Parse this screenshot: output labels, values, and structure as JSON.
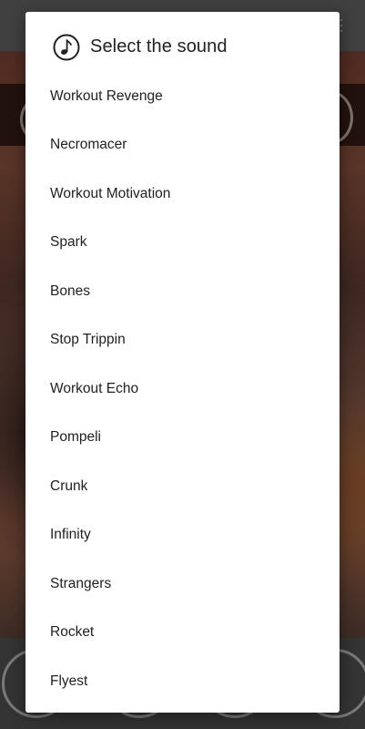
{
  "dialog": {
    "title": "Select the sound",
    "icon": "music-note-icon",
    "items": [
      {
        "label": "Workout Revenge"
      },
      {
        "label": "Necromacer"
      },
      {
        "label": "Workout Motivation"
      },
      {
        "label": "Spark"
      },
      {
        "label": "Bones"
      },
      {
        "label": "Stop Trippin"
      },
      {
        "label": "Workout Echo"
      },
      {
        "label": "Pompeli"
      },
      {
        "label": "Crunk"
      },
      {
        "label": "Infinity"
      },
      {
        "label": "Strangers"
      },
      {
        "label": "Rocket"
      },
      {
        "label": "Flyest"
      }
    ]
  },
  "colors": {
    "dialog_background": "#ffffff",
    "text": "#212121",
    "scrim": "#000000"
  }
}
